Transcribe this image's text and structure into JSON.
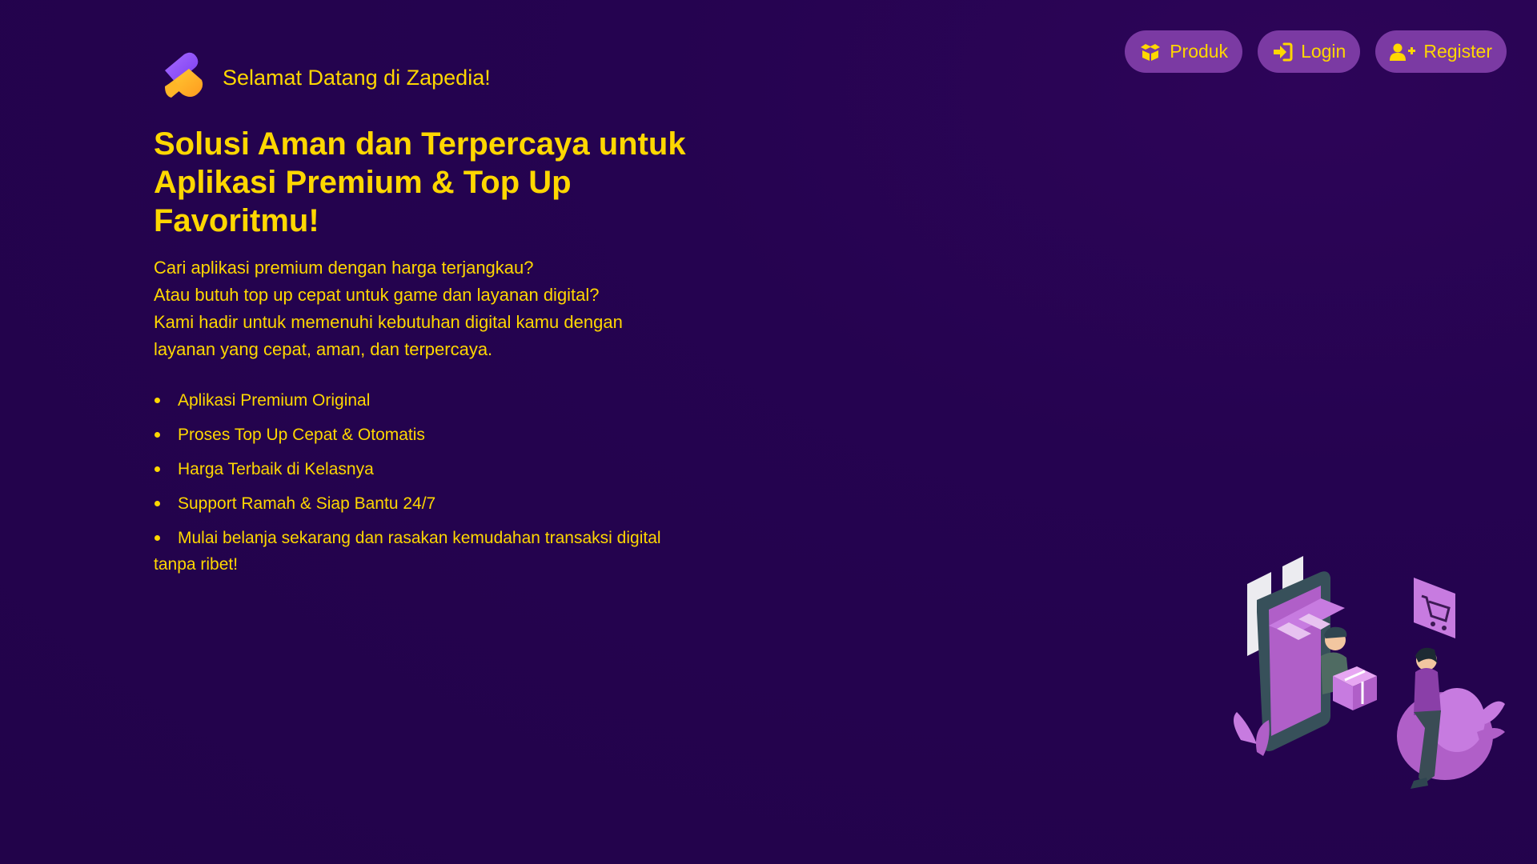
{
  "nav": {
    "items": [
      {
        "label": "Produk",
        "icon": "box-open-icon"
      },
      {
        "label": "Login",
        "icon": "sign-in-icon"
      },
      {
        "label": "Register",
        "icon": "user-plus-icon"
      }
    ]
  },
  "brand": {
    "title": "Selamat Datang di Zapedia!",
    "logo": "zapedia-logo"
  },
  "hero": {
    "heading": "Solusi Aman dan Terpercaya untuk Aplikasi Premium & Top Up Favoritmu!",
    "description_lines": [
      "Cari aplikasi premium dengan harga terjangkau?",
      "Atau butuh top up cepat untuk game dan layanan digital?",
      "Kami hadir untuk memenuhi kebutuhan digital kamu dengan",
      "layanan yang cepat, aman, dan terpercaya."
    ],
    "features": [
      "Aplikasi Premium Original",
      "Proses Top Up Cepat & Otomatis",
      "Harga Terbaik di Kelasnya",
      "Support Ramah & Siap Bantu 24/7",
      "Mulai belanja sekarang dan rasakan kemudahan transaksi digital tanpa ribet!"
    ]
  },
  "colors": {
    "background": "#22034a",
    "accent": "#ffd700",
    "button": "#7b3aa3"
  }
}
